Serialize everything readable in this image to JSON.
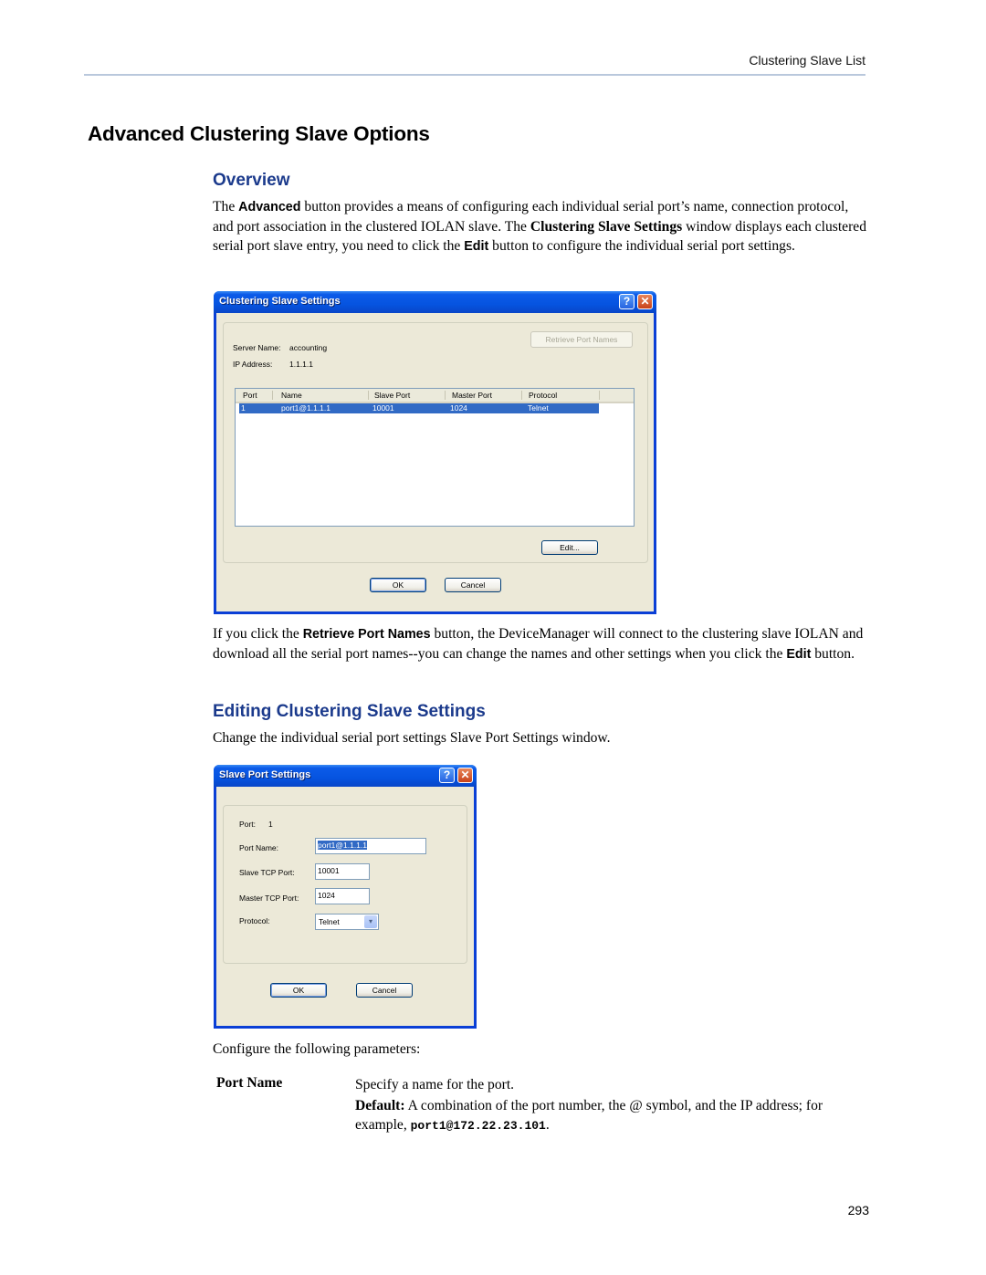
{
  "header": {
    "running_title": "Clustering Slave List"
  },
  "section_title": "Advanced Clustering Slave Options",
  "overview": {
    "heading": "Overview",
    "paragraph": {
      "t1": "The ",
      "b1": "Advanced",
      "t2": " button provides a means of configuring each individual serial port’s name, connection protocol, and port association in the clustered IOLAN slave. The ",
      "b2": "Clustering Slave Settings",
      "t3": " window displays each clustered serial port slave entry, you need to click the ",
      "b3": "Edit",
      "t4": " button to configure the individual serial port settings."
    }
  },
  "clustering_dialog": {
    "title": "Clustering Slave Settings",
    "help_glyph": "?",
    "close_glyph": "✕",
    "server_name_label": "Server Name:",
    "server_name_value": "accounting",
    "ip_address_label": "IP Address:",
    "ip_address_value": "1.1.1.1",
    "retrieve_button": "Retrieve Port Names",
    "columns": [
      "Port",
      "Name",
      "Slave Port",
      "Master Port",
      "Protocol"
    ],
    "rows": [
      {
        "port": "1",
        "name": "port1@1.1.1.1",
        "slave_port": "10001",
        "master_port": "1024",
        "protocol": "Telnet",
        "selected": true
      }
    ],
    "edit_button": "Edit...",
    "ok_button": "OK",
    "cancel_button": "Cancel"
  },
  "retrieve_paragraph": {
    "t1": "If you click the ",
    "b1": "Retrieve Port Names",
    "t2": " button, the DeviceManager will connect to the clustering slave IOLAN and download all the serial port names--you can change the names and other settings when you click the ",
    "b2": "Edit",
    "t3": " button."
  },
  "editing": {
    "heading": "Editing Clustering Slave Settings",
    "paragraph": "Change the individual serial port settings Slave Port Settings window."
  },
  "slave_port_dialog": {
    "title": "Slave Port Settings",
    "help_glyph": "?",
    "close_glyph": "✕",
    "port_label": "Port:",
    "port_value": "1",
    "port_name_label": "Port Name:",
    "port_name_value": "port1@1.1.1.1",
    "slave_tcp_label": "Slave TCP Port:",
    "slave_tcp_value": "10001",
    "master_tcp_label": "Master TCP Port:",
    "master_tcp_value": "1024",
    "protocol_label": "Protocol:",
    "protocol_value": "Telnet",
    "dropdown_glyph": "▾",
    "ok_button": "OK",
    "cancel_button": "Cancel"
  },
  "configure_intro": "Configure the following parameters:",
  "parameters": [
    {
      "term": "Port Name",
      "description": "Specify a name for the port.",
      "default_label": "Default:",
      "default_text": " A combination of the port number, the @ symbol, and the IP address; for example, ",
      "example": "port1@172.22.23.101",
      "end": "."
    }
  ],
  "footer": {
    "page_number": "293"
  }
}
